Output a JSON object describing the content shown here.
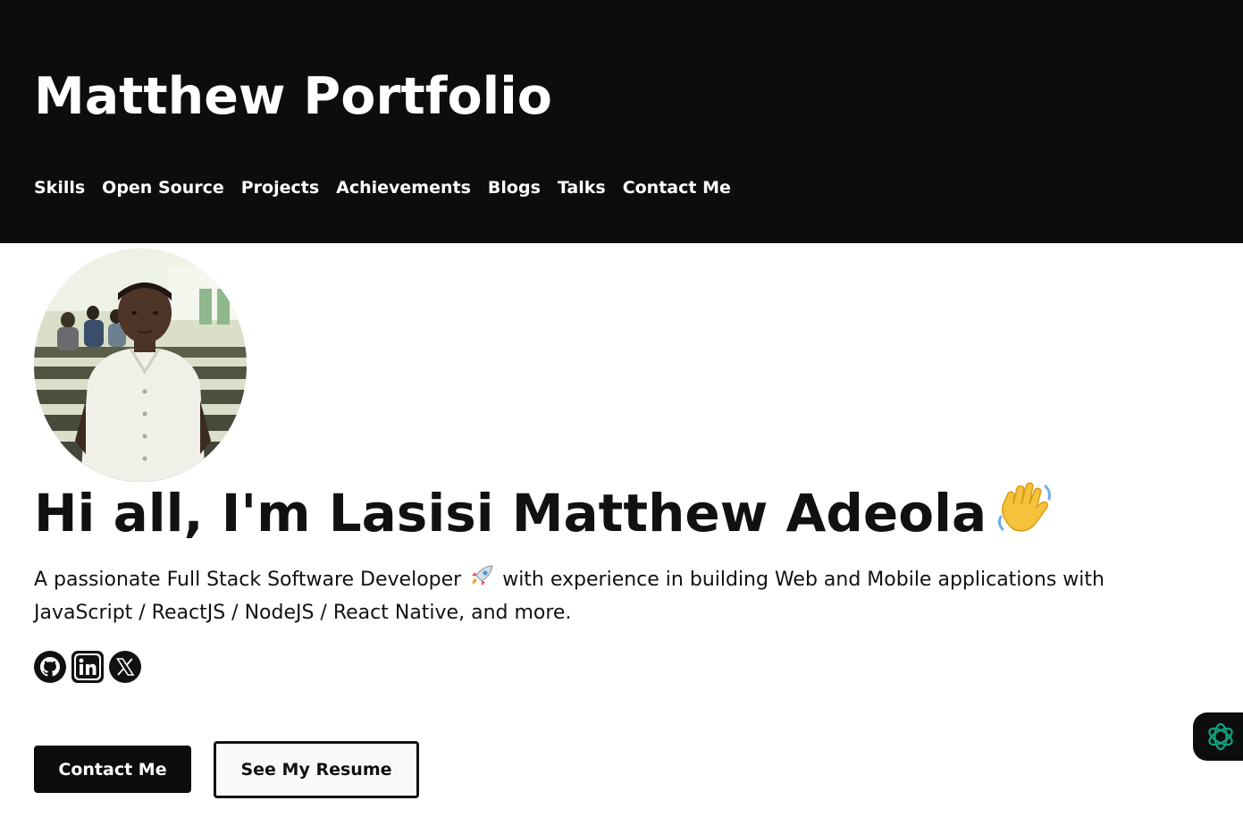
{
  "header": {
    "title": "Matthew Portfolio",
    "nav": [
      {
        "label": "Skills"
      },
      {
        "label": "Open Source"
      },
      {
        "label": "Projects"
      },
      {
        "label": "Achievements"
      },
      {
        "label": "Blogs"
      },
      {
        "label": "Talks"
      },
      {
        "label": "Contact Me"
      }
    ]
  },
  "hero": {
    "greeting": "Hi all, I'm Lasisi Matthew Adeola",
    "greeting_icon": "waving-hand-emoji",
    "intro_before": "A passionate Full Stack Software Developer",
    "intro_icon": "rocket-emoji",
    "intro_after": "with experience in building Web and Mobile applications with JavaScript / ReactJS / NodeJS / React Native, and more.",
    "avatar_icon": "profile-photo"
  },
  "socials": [
    {
      "icon": "github-icon"
    },
    {
      "icon": "linkedin-icon"
    },
    {
      "icon": "x-twitter-icon"
    }
  ],
  "buttons": {
    "contact_label": "Contact Me",
    "resume_label": "See My Resume"
  },
  "colors": {
    "header_bg": "#0e0c0d",
    "text": "#111111",
    "assistant_accent": "#10a37f"
  }
}
